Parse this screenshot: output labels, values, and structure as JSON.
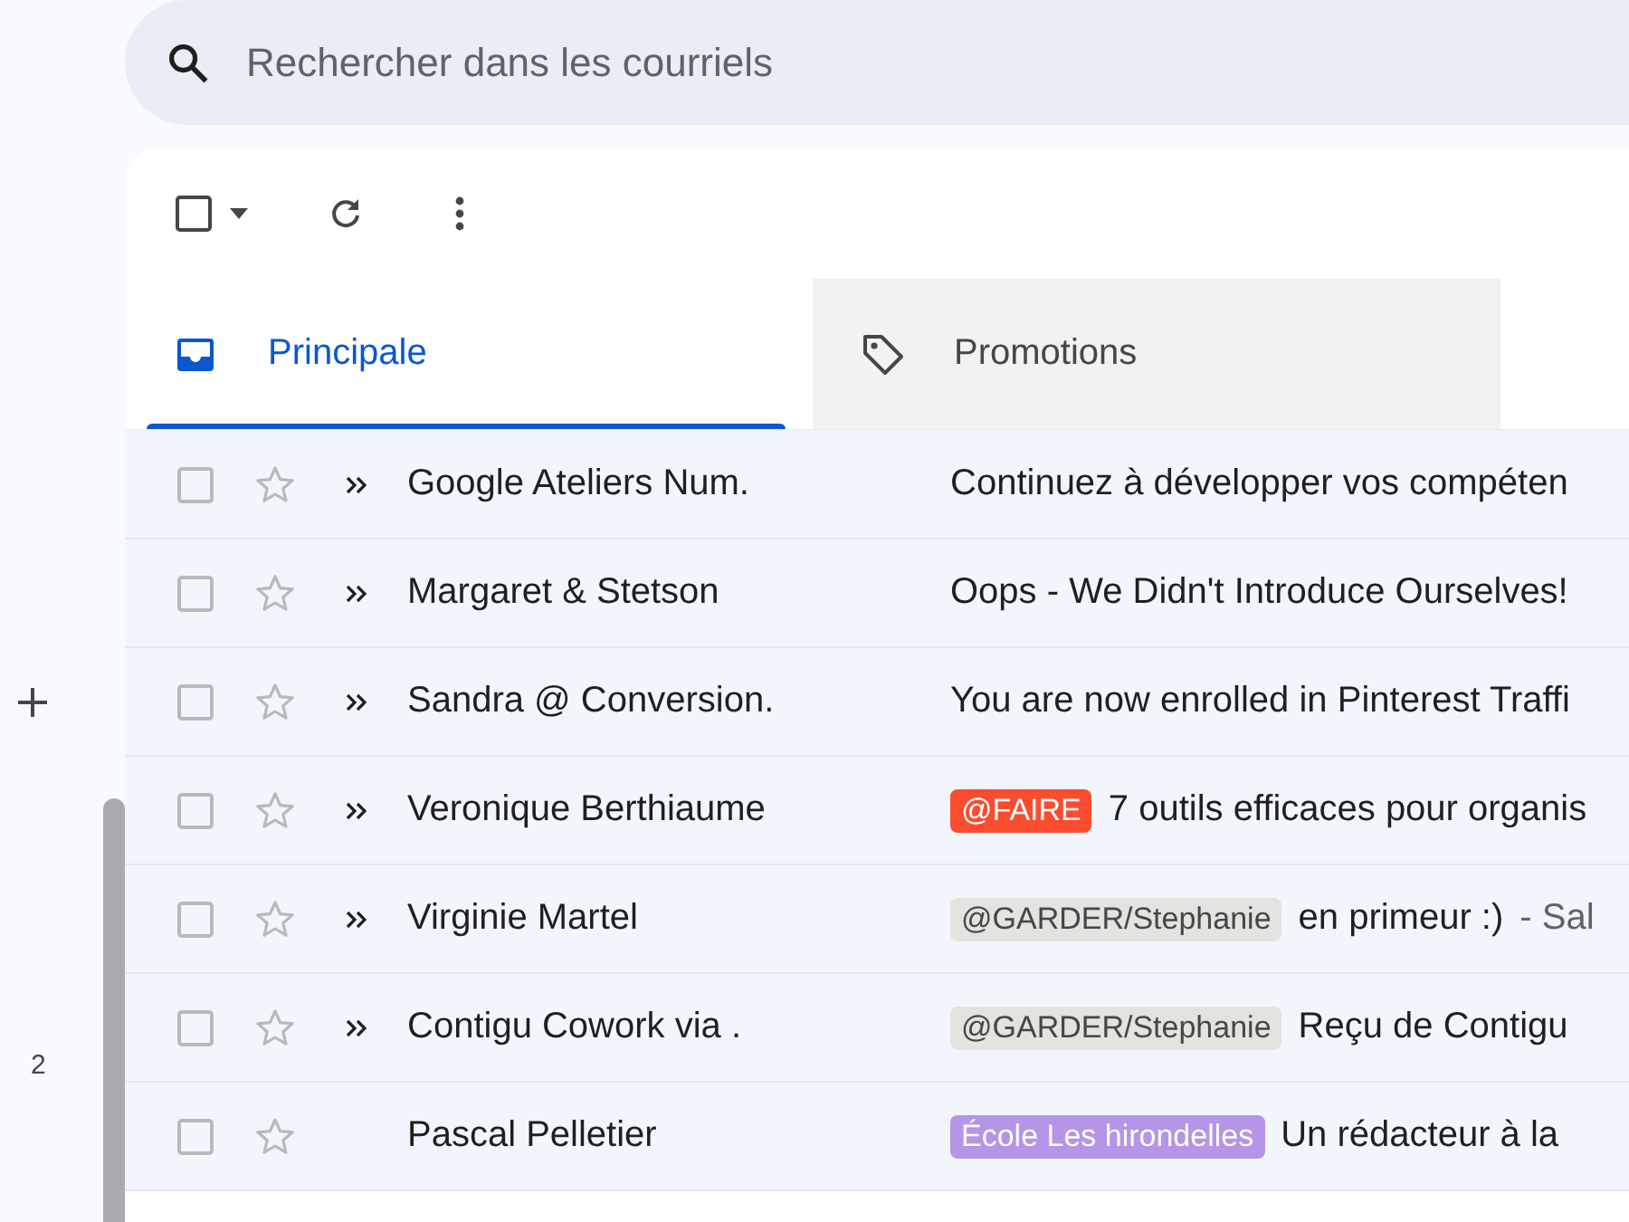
{
  "search": {
    "placeholder": "Rechercher dans les courriels"
  },
  "rail": {
    "count": "2"
  },
  "toolbar": {
    "select_all_checked": false
  },
  "tabs": [
    {
      "label": "Principale",
      "kind": "inbox",
      "selected": true
    },
    {
      "label": "Promotions",
      "kind": "tag",
      "selected": false
    }
  ],
  "rows": [
    {
      "checked": false,
      "starred": false,
      "important": true,
      "sender": "Google Ateliers Num.",
      "subject": "Continuez à développer vos compéten"
    },
    {
      "checked": false,
      "starred": false,
      "important": true,
      "sender": "Margaret & Stetson",
      "subject": "Oops - We Didn't Introduce Ourselves!"
    },
    {
      "checked": false,
      "starred": false,
      "important": true,
      "sender": "Sandra @ Conversion.",
      "subject": "You are now enrolled in Pinterest Traffi"
    },
    {
      "checked": false,
      "starred": false,
      "important": true,
      "sender": "Veronique Berthiaume",
      "label": {
        "text": "@FAIRE",
        "color": "#fb4c2f"
      },
      "subject": "7 outils efficaces pour organis"
    },
    {
      "checked": false,
      "starred": false,
      "important": true,
      "sender": "Virginie Martel",
      "label": {
        "text": "@GARDER/Stephanie",
        "color": "#e3e3df"
      },
      "subject": "en primeur :)",
      "snippet": "- Sal"
    },
    {
      "checked": false,
      "starred": false,
      "important": true,
      "sender": "Contigu Cowork via .",
      "label": {
        "text": "@GARDER/Stephanie",
        "color": "#e3e3df"
      },
      "subject": "Reçu de Contigu"
    },
    {
      "checked": false,
      "starred": false,
      "important": false,
      "sender": "Pascal Pelletier",
      "label": {
        "text": "École Les hirondelles",
        "color": "#b694e8"
      },
      "subject": "Un rédacteur à la"
    }
  ]
}
